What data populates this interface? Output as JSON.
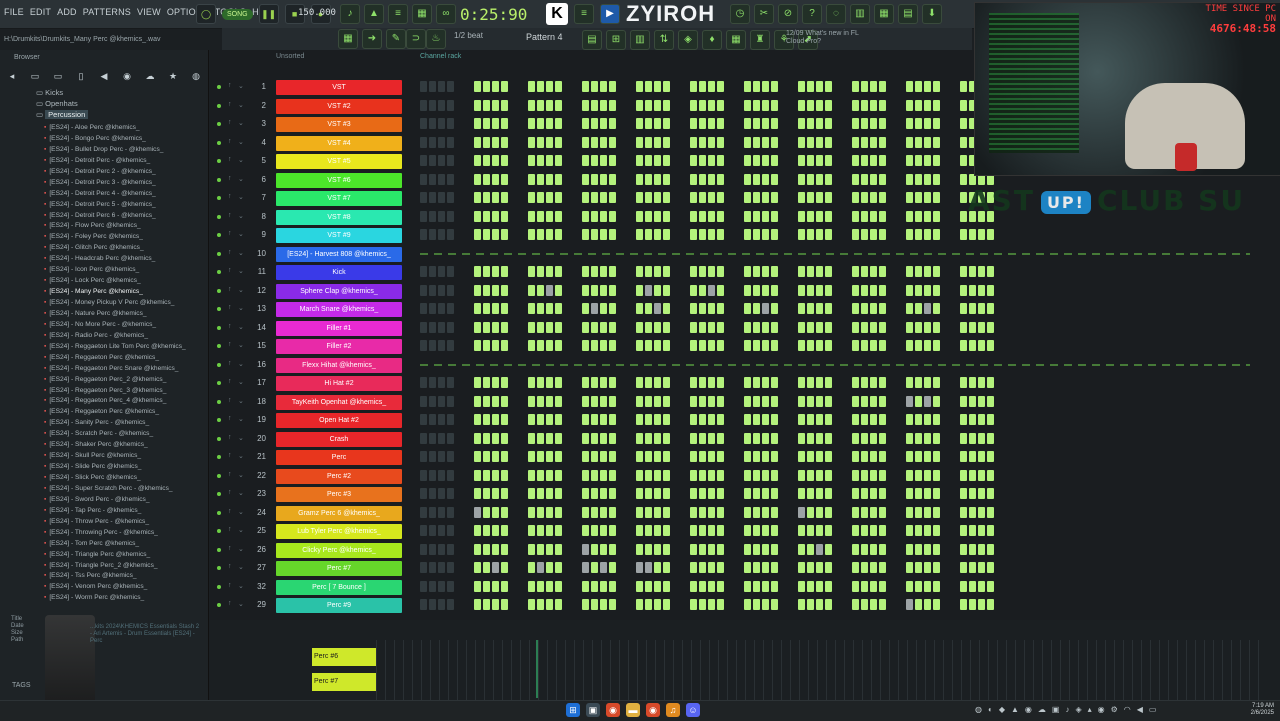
{
  "menu": [
    "FILE",
    "EDIT",
    "ADD",
    "PATTERNS",
    "VIEW",
    "OPTIONS",
    "TOOLS",
    "HELP"
  ],
  "transport": {
    "song_mode": "SONG",
    "tempo": "150.000",
    "time": "0:25:90"
  },
  "brand": {
    "logo": "K",
    "name": "ZYIROH"
  },
  "toolbar2": {
    "snap": "1/2 beat",
    "pattern": "Pattern 4",
    "news_date": "12/09",
    "news_text": "What's new in FL Cloud Pro?"
  },
  "browser": {
    "path": "H:\\Drumkits\\Drumkits_Many Perc @khemics_.wav",
    "title": "Browser",
    "tree": [
      "Kicks",
      "Openhats",
      "Percussion"
    ],
    "selected": "Percussion",
    "files": [
      "[ES24] - Aloe Perc @khemics_",
      "[ES24] - Bongo Perc @khemics_",
      "[ES24] - Bullet Drop Perc - @khemics_",
      "[ES24] - Detroit Perc - @khemics_",
      "[ES24] - Detroit Perc 2 - @khemics_",
      "[ES24] - Detroit Perc 3 - @khemics_",
      "[ES24] - Detroit Perc 4 - @khemics_",
      "[ES24] - Detroit Perc 5 - @khemics_",
      "[ES24] - Detroit Perc 6 - @khemics_",
      "[ES24] - Flow Perc @khemics_",
      "[ES24] - Foley Perc @khemics_",
      "[ES24] - Glitch Perc @khemics_",
      "[ES24] - Headcrab Perc @khemics_",
      "[ES24] - Icon Perc @khemics_",
      "[ES24] - Lock Perc @khemics_",
      "[ES24] - Many Perc @khemics_",
      "[ES24] - Money Pickup V Perc @khemics_",
      "[ES24] - Nature Perc @khemics_",
      "[ES24] - No More Perc - @khemics_",
      "[ES24] - Radio Perc - @khemics_",
      "[ES24] - Reggaeton Lite Tom Perc @khemics_",
      "[ES24] - Reggaeton Perc @khemics_",
      "[ES24] - Reggaeton Perc Snare @khemics_",
      "[ES24] - Reggaeton Perc_2 @khemics_",
      "[ES24] - Reggaeton Perc_3 @khemics_",
      "[ES24] - Reggaeton Perc_4 @khemics_",
      "[ES24] - Reggaeton Perc @khemics_",
      "[ES24] - Sanity Perc - @khemics_",
      "[ES24] - Scratch Perc - @khemics_",
      "[ES24] - Shaker Perc @khemics_",
      "[ES24] - Skull Perc @khemics_",
      "[ES24] - Slide Perc @khemics_",
      "[ES24] - Slick Perc @khemics_",
      "[ES24] - Super Scratch Perc - @khemics_",
      "[ES24] - Sword Perc - @khemics_",
      "[ES24] - Tap Perc - @khemics_",
      "[ES24] - Throw Perc - @khemics_",
      "[ES24] - Throwing Perc - @khemics_",
      "[ES24] - Tom Perc @khemics_",
      "[ES24] - Triangle Perc @khemics_",
      "[ES24] - Triangle Perc_2 @khemics_",
      "[ES24] - Tss Perc @khemics_",
      "[ES24] - Venom Perc @khemics_",
      "[ES24] - Worm Perc @khemics_"
    ],
    "highlight_index": 15,
    "info_labels": [
      "Title",
      "Date",
      "Size",
      "Path"
    ],
    "info_value": "...kits 2024\\KHEMICS Essentials Stash 2 - Ari Artemis - Drum Essentials [ES24] - Perc",
    "tags_label": "TAGS"
  },
  "rack": {
    "filter": "Unsorted",
    "title": "Channel rack"
  },
  "channels": [
    {
      "n": "1",
      "name": "VST",
      "color": "#e8262a"
    },
    {
      "n": "2",
      "name": "VST #2",
      "color": "#e8321d"
    },
    {
      "n": "3",
      "name": "VST #3",
      "color": "#e86a16"
    },
    {
      "n": "4",
      "name": "VST #4",
      "color": "#f0b01a"
    },
    {
      "n": "5",
      "name": "VST #5",
      "color": "#e8e81d"
    },
    {
      "n": "6",
      "name": "VST #6",
      "color": "#4ce62a"
    },
    {
      "n": "7",
      "name": "VST #7",
      "color": "#2ae86a"
    },
    {
      "n": "8",
      "name": "VST #8",
      "color": "#2ae8b0"
    },
    {
      "n": "9",
      "name": "VST #9",
      "color": "#2ad6e0"
    },
    {
      "n": "10",
      "name": "[ES24] - Harvest 808 @khemics_",
      "color": "#2a6ae8"
    },
    {
      "n": "11",
      "name": "Kick",
      "color": "#3a3ae8"
    },
    {
      "n": "12",
      "name": "Sphere Clap @khemics_",
      "color": "#8a2ae8"
    },
    {
      "n": "13",
      "name": "March Snare @khemics_",
      "color": "#c42ae8"
    },
    {
      "n": "14",
      "name": "Filler #1",
      "color": "#e82ad2"
    },
    {
      "n": "15",
      "name": "Filler #2",
      "color": "#e82aa8"
    },
    {
      "n": "16",
      "name": "Flexx Hihat @khemics_",
      "color": "#e82a84"
    },
    {
      "n": "17",
      "name": "Hi Hat #2",
      "color": "#e82a5a"
    },
    {
      "n": "18",
      "name": "TayKeith Openhat @khemics_",
      "color": "#e82a3a"
    },
    {
      "n": "19",
      "name": "Open Hat #2",
      "color": "#e8262a"
    },
    {
      "n": "20",
      "name": "Crash",
      "color": "#e8262a"
    },
    {
      "n": "21",
      "name": "Perc",
      "color": "#e8361d"
    },
    {
      "n": "22",
      "name": "Perc #2",
      "color": "#e84a1d"
    },
    {
      "n": "23",
      "name": "Perc #3",
      "color": "#e8721d"
    },
    {
      "n": "24",
      "name": "Gramz Perc 6 @khemics_",
      "color": "#e8a81d"
    },
    {
      "n": "25",
      "name": "Lub Tyler Perc @khemics_",
      "color": "#d6e81d"
    },
    {
      "n": "26",
      "name": "Clicky Perc @khemics_",
      "color": "#a8e81d"
    },
    {
      "n": "27",
      "name": "Perc #7",
      "color": "#66d62a"
    },
    {
      "n": "32",
      "name": "Perc [ 7 Bounce ]",
      "color": "#2ad672"
    },
    {
      "n": "29",
      "name": "Perc #9",
      "color": "#2ac2a8"
    }
  ],
  "piano_notes": [
    "Perc #6",
    "Perc #7"
  ],
  "stream": {
    "time_label": "TIME SINCE PC ON",
    "time_value": "4676:48:58",
    "banner_left": "AST",
    "banner_badge": "UP!",
    "banner_right": "CLUB SU"
  },
  "clock": {
    "time": "7:19 AM",
    "date": "2/6/2025"
  },
  "colors": {
    "step_on": "#b4f27c",
    "step_off": "#323b3f",
    "accent": "#9ad14f"
  }
}
